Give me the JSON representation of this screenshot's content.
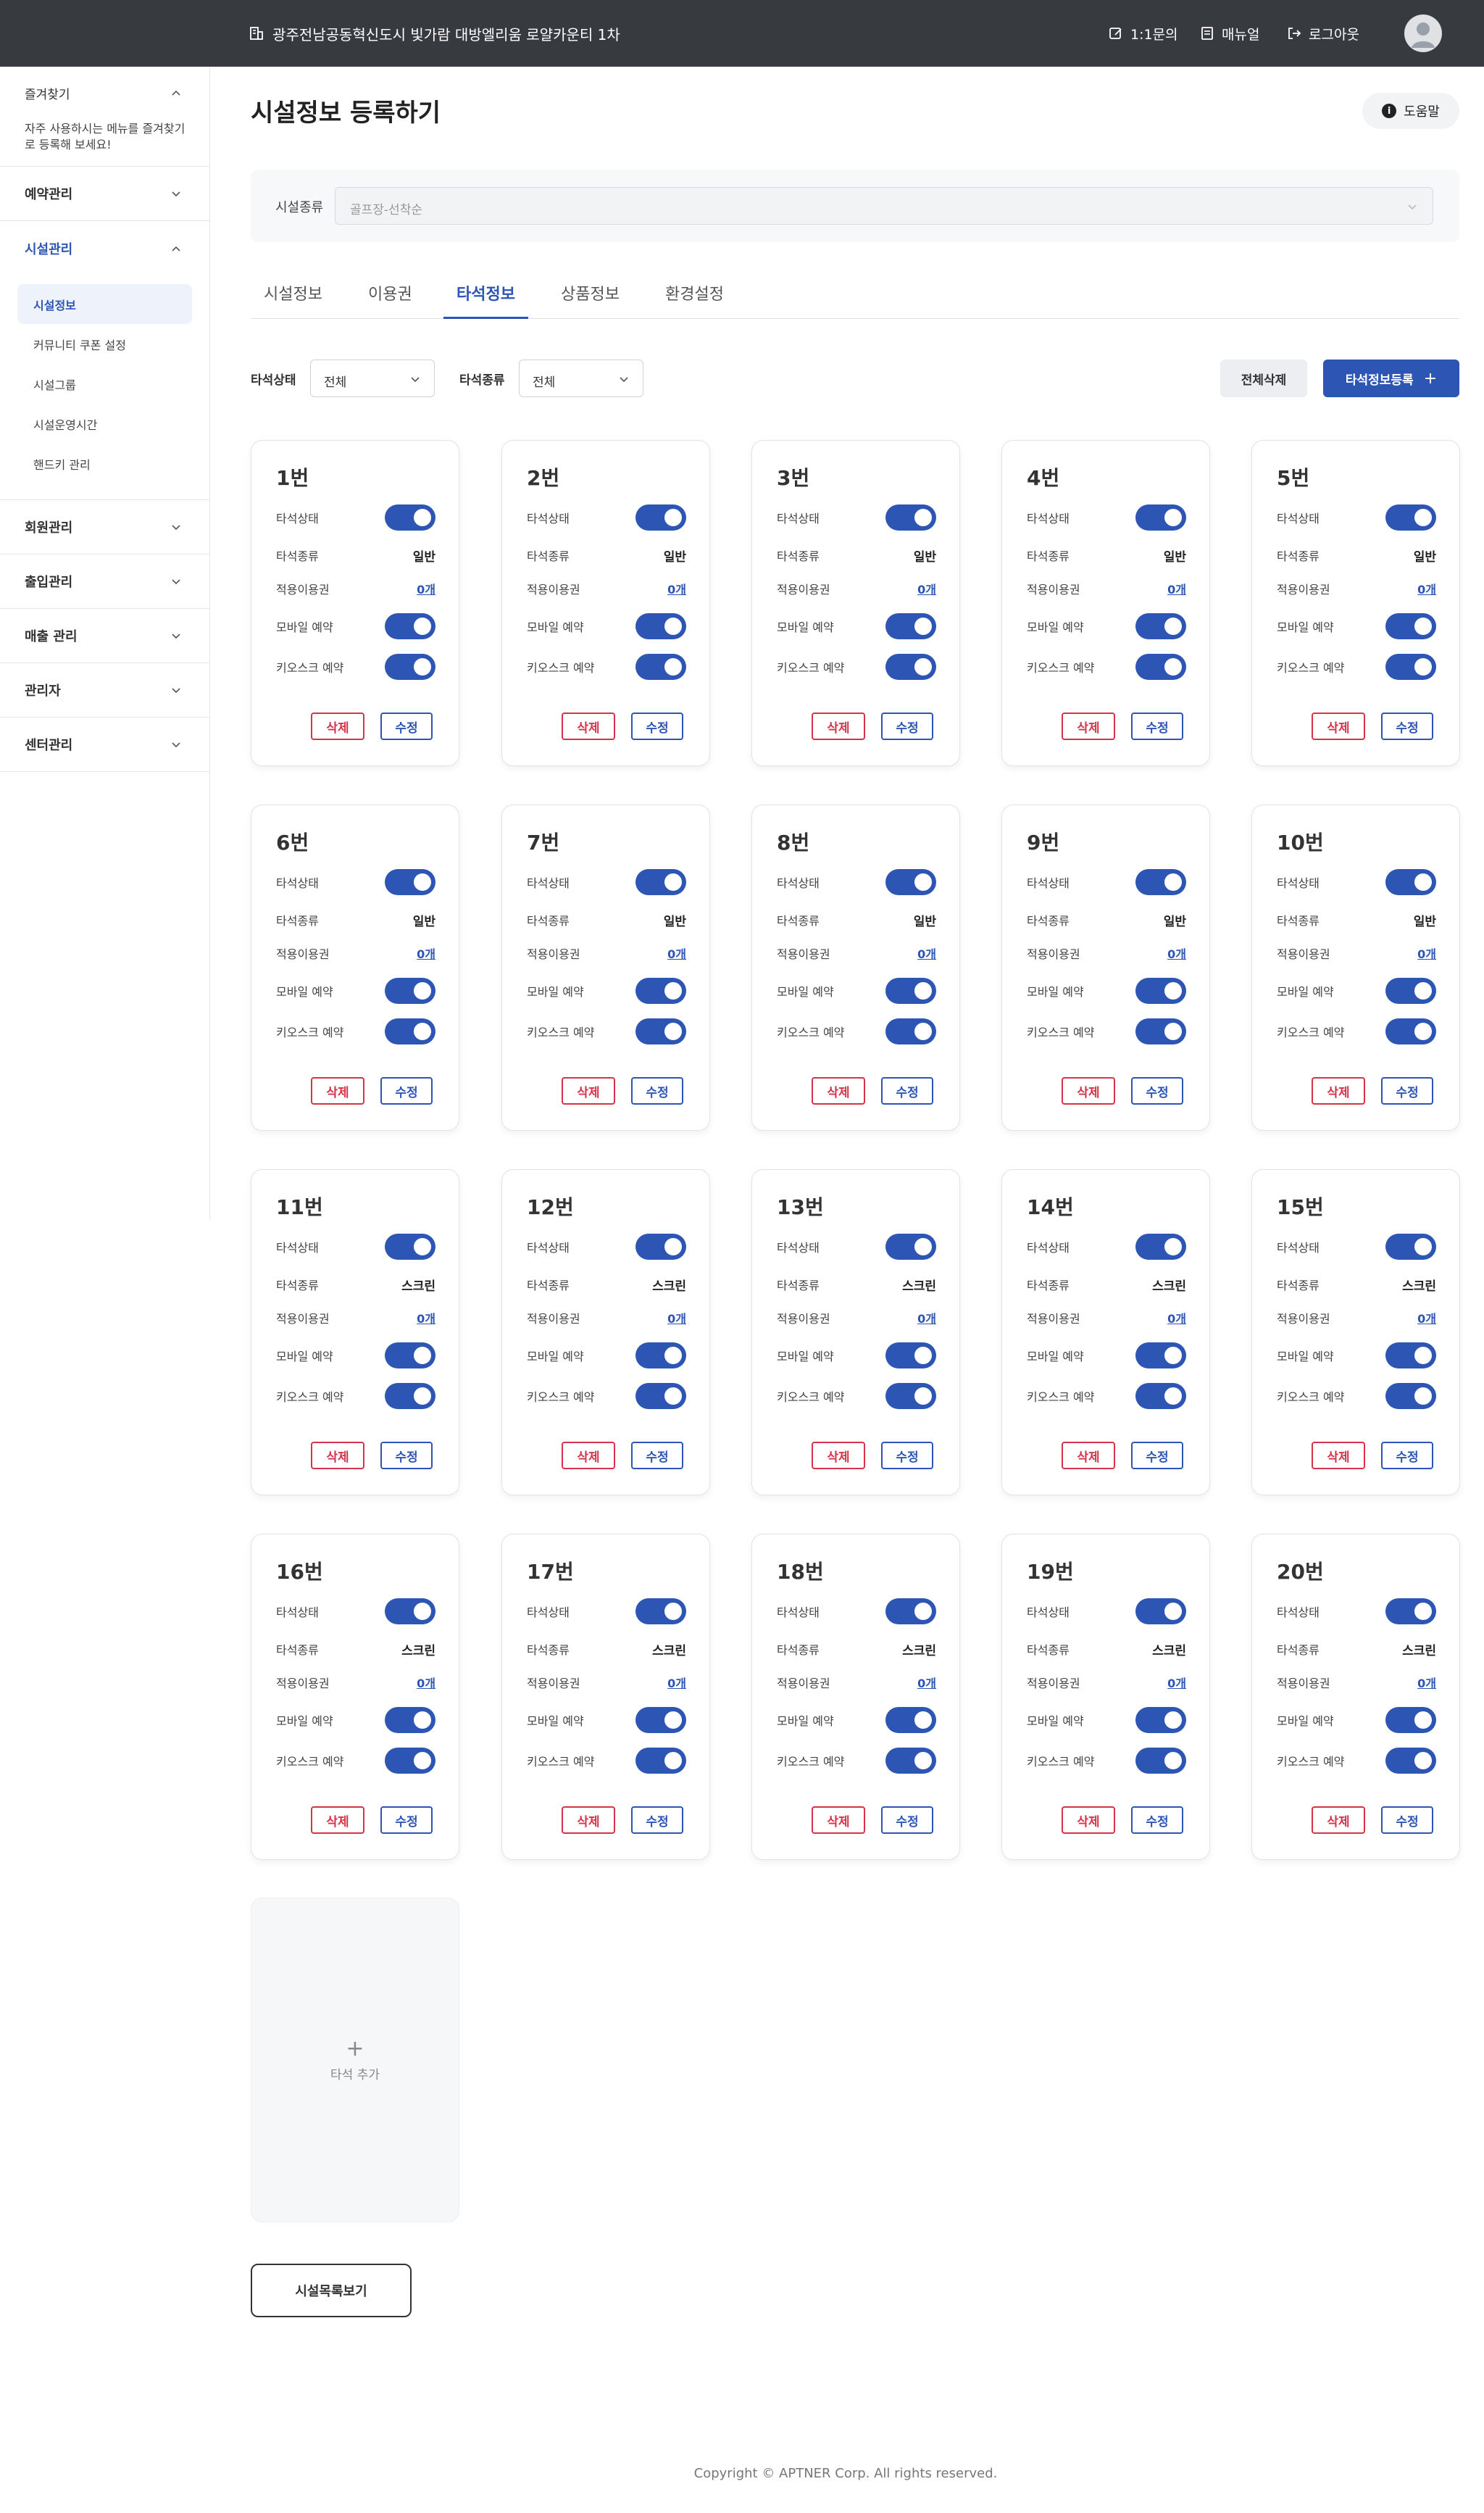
{
  "header": {
    "site_name": "광주전남공동혁신도시 빛가람 대방엘리움 로얄카운티 1차",
    "inquiry": "1:1문의",
    "manual": "매뉴얼",
    "logout": "로그아웃"
  },
  "sidebar": {
    "favorites_title": "즐겨찾기",
    "favorites_desc": "자주 사용하시는 메뉴를 즐겨찾기로 등록해 보세요!",
    "menus": [
      {
        "label": "예약관리"
      },
      {
        "label": "시설관리"
      },
      {
        "label": "회원관리"
      },
      {
        "label": "출입관리"
      },
      {
        "label": "매출 관리"
      },
      {
        "label": "관리자"
      },
      {
        "label": "센터관리"
      }
    ],
    "submenu": [
      "시설정보",
      "커뮤니티 쿠폰 설정",
      "시설그룹",
      "시설운영시간",
      "핸드키 관리"
    ]
  },
  "page": {
    "title": "시설정보 등록하기",
    "help": "도움말",
    "facility_type_label": "시설종류",
    "facility_type_value": "골프장-선착순",
    "tabs": [
      "시설정보",
      "이용권",
      "타석정보",
      "상품정보",
      "환경설정"
    ],
    "active_tab": "타석정보",
    "filter_status_label": "타석상태",
    "filter_status_value": "전체",
    "filter_type_label": "타석종류",
    "filter_type_value": "전체",
    "delete_all": "전체삭제",
    "register": "타석정보등록",
    "register_icon": "+"
  },
  "card_labels": {
    "status": "타석상태",
    "type": "타석종류",
    "ticket": "적용이용권",
    "mobile": "모바일 예약",
    "kiosk": "키오스크 예약",
    "delete": "삭제",
    "edit": "수정"
  },
  "cards": [
    {
      "no": "1번",
      "type": "일반",
      "ticket": "0개",
      "status_on": true,
      "mobile_on": true,
      "kiosk_on": true
    },
    {
      "no": "2번",
      "type": "일반",
      "ticket": "0개",
      "status_on": true,
      "mobile_on": true,
      "kiosk_on": true
    },
    {
      "no": "3번",
      "type": "일반",
      "ticket": "0개",
      "status_on": true,
      "mobile_on": true,
      "kiosk_on": true
    },
    {
      "no": "4번",
      "type": "일반",
      "ticket": "0개",
      "status_on": true,
      "mobile_on": true,
      "kiosk_on": true
    },
    {
      "no": "5번",
      "type": "일반",
      "ticket": "0개",
      "status_on": true,
      "mobile_on": true,
      "kiosk_on": true
    },
    {
      "no": "6번",
      "type": "일반",
      "ticket": "0개",
      "status_on": true,
      "mobile_on": true,
      "kiosk_on": true
    },
    {
      "no": "7번",
      "type": "일반",
      "ticket": "0개",
      "status_on": true,
      "mobile_on": true,
      "kiosk_on": true
    },
    {
      "no": "8번",
      "type": "일반",
      "ticket": "0개",
      "status_on": true,
      "mobile_on": true,
      "kiosk_on": true
    },
    {
      "no": "9번",
      "type": "일반",
      "ticket": "0개",
      "status_on": true,
      "mobile_on": true,
      "kiosk_on": true
    },
    {
      "no": "10번",
      "type": "일반",
      "ticket": "0개",
      "status_on": true,
      "mobile_on": true,
      "kiosk_on": true
    },
    {
      "no": "11번",
      "type": "스크린",
      "ticket": "0개",
      "status_on": true,
      "mobile_on": true,
      "kiosk_on": true
    },
    {
      "no": "12번",
      "type": "스크린",
      "ticket": "0개",
      "status_on": true,
      "mobile_on": true,
      "kiosk_on": true
    },
    {
      "no": "13번",
      "type": "스크린",
      "ticket": "0개",
      "status_on": true,
      "mobile_on": true,
      "kiosk_on": true
    },
    {
      "no": "14번",
      "type": "스크린",
      "ticket": "0개",
      "status_on": true,
      "mobile_on": true,
      "kiosk_on": true
    },
    {
      "no": "15번",
      "type": "스크린",
      "ticket": "0개",
      "status_on": true,
      "mobile_on": true,
      "kiosk_on": true
    },
    {
      "no": "16번",
      "type": "스크린",
      "ticket": "0개",
      "status_on": true,
      "mobile_on": true,
      "kiosk_on": true
    },
    {
      "no": "17번",
      "type": "스크린",
      "ticket": "0개",
      "status_on": true,
      "mobile_on": true,
      "kiosk_on": true
    },
    {
      "no": "18번",
      "type": "스크린",
      "ticket": "0개",
      "status_on": true,
      "mobile_on": true,
      "kiosk_on": true
    },
    {
      "no": "19번",
      "type": "스크린",
      "ticket": "0개",
      "status_on": true,
      "mobile_on": true,
      "kiosk_on": true
    },
    {
      "no": "20번",
      "type": "스크린",
      "ticket": "0개",
      "status_on": true,
      "mobile_on": true,
      "kiosk_on": true
    }
  ],
  "add_card": {
    "icon": "+",
    "label": "타석 추가"
  },
  "list_button": "시설목록보기",
  "footer": "Copyright © APTNER Corp. All rights reserved.",
  "colors": {
    "primary": "#2d55b4",
    "danger": "#d6334a",
    "topbar": "#373a3f"
  }
}
